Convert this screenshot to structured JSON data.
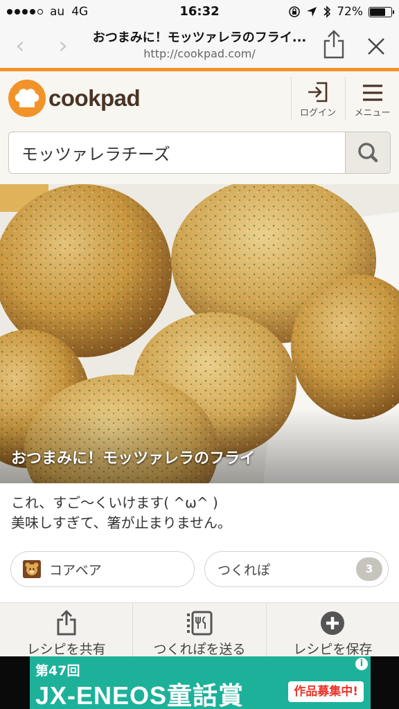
{
  "status_bar": {
    "carrier": "au",
    "network": "4G",
    "time": "16:32",
    "battery": "72%",
    "battery_level": 0.72
  },
  "browser": {
    "page_title": "おつまみに！モッツァレラのフライ...",
    "url": "http://cookpad.com/"
  },
  "header": {
    "logo_text": "cookpad",
    "login_label": "ログイン",
    "menu_label": "メニュー"
  },
  "search": {
    "value": "モッツァレラチーズ"
  },
  "recipe": {
    "title": "おつまみに！モッツァレラのフライ",
    "description_line1": "これ、すご〜くいけます( ^ω^ )",
    "description_line2": "美味しすぎて、箸が止まりません。",
    "author": "コアベア",
    "tsukurepo_label": "つくれぽ",
    "tsukurepo_count": "3"
  },
  "toolbar": {
    "share_label": "レシピを共有",
    "send_label": "つくれぽを送る",
    "save_label": "レシピを保存"
  },
  "ad": {
    "sub": "第47回",
    "main": "JX-ENEOS童話賞",
    "tag": "作品募集中!",
    "info_icon": "i"
  },
  "colors": {
    "accent": "#f2932a",
    "brand_text": "#4a3426",
    "ad_bg": "#1db19a"
  }
}
